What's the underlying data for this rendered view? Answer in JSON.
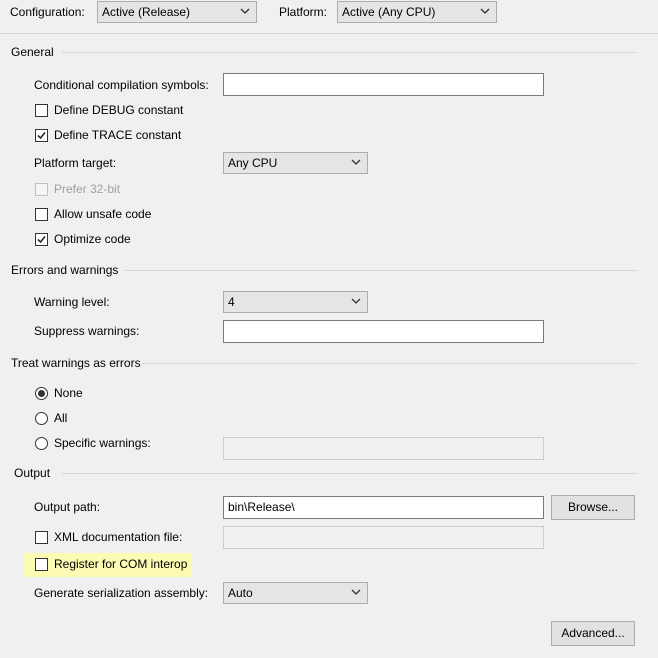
{
  "top_bar": {
    "configuration_label": "Configuration:",
    "configuration_value": "Active (Release)",
    "platform_label": "Platform:",
    "platform_value": "Active (Any CPU)"
  },
  "general": {
    "title": "General",
    "conditional_symbols_label": "Conditional compilation symbols:",
    "conditional_symbols_value": "",
    "define_debug_label": "Define DEBUG constant",
    "define_debug_checked": false,
    "define_trace_label": "Define TRACE constant",
    "define_trace_checked": true,
    "platform_target_label": "Platform target:",
    "platform_target_value": "Any CPU",
    "prefer32_label": "Prefer 32-bit",
    "prefer32_checked": false,
    "prefer32_enabled": false,
    "allow_unsafe_label": "Allow unsafe code",
    "allow_unsafe_checked": false,
    "optimize_label": "Optimize code",
    "optimize_checked": true
  },
  "errors_warnings": {
    "title": "Errors and warnings",
    "warning_level_label": "Warning level:",
    "warning_level_value": "4",
    "suppress_label": "Suppress warnings:",
    "suppress_value": ""
  },
  "treat_warnings": {
    "title": "Treat warnings as errors",
    "options": [
      "None",
      "All",
      "Specific warnings:"
    ],
    "selected": "None",
    "specific_value": ""
  },
  "output": {
    "title": "Output",
    "output_path_label": "Output path:",
    "output_path_value": "bin\\Release\\",
    "browse_label": "Browse...",
    "xml_doc_label": "XML documentation file:",
    "xml_doc_checked": false,
    "xml_doc_value": "",
    "com_interop_label": "Register for COM interop",
    "com_interop_checked": false,
    "com_interop_highlight": "#fbfbb4",
    "serialization_label": "Generate serialization assembly:",
    "serialization_value": "Auto"
  },
  "advanced_label": "Advanced..."
}
